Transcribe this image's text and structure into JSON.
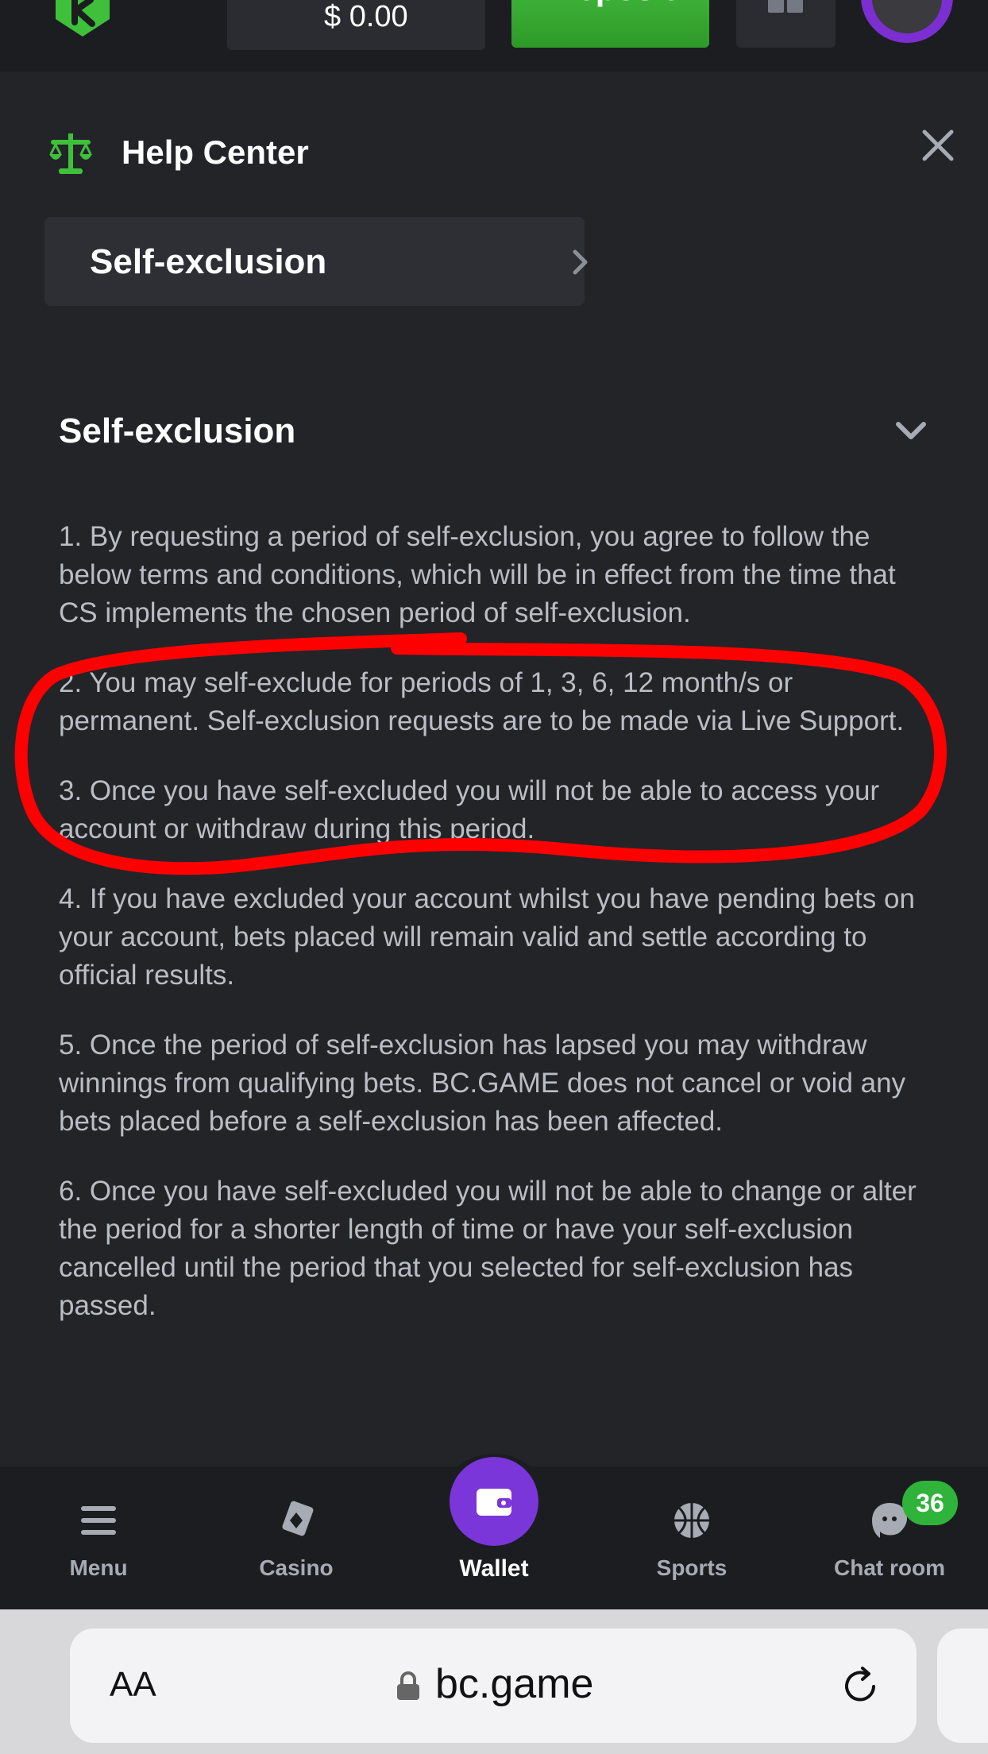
{
  "header": {
    "balance": "$ 0.00",
    "deposit_label": "Deposit"
  },
  "help_center": {
    "title": "Help Center",
    "selector_label": "Self-exclusion",
    "section_title": "Self-exclusion",
    "paragraphs": [
      "1. By requesting a period of self-exclusion, you agree to follow the below terms and conditions, which will be in effect from the time that CS implements the chosen period of self-exclusion.",
      "2. You may self-exclude for periods of 1, 3, 6, 12 month/s or permanent. Self-exclusion requests are to be made via Live Support.",
      "3. Once you have self-excluded you will not be able to access your account or withdraw during this period.",
      "4. If you have excluded your account whilst you have pending bets on your account, bets placed will remain valid and settle according to official results.",
      "5. Once the period of self-exclusion has lapsed you may withdraw winnings from qualifying bets. BC.GAME does not cancel or void any bets placed before a self-exclusion has been affected.",
      "6. Once you have self-excluded you will not be able to change or alter the period for a shorter length of time or have your self-exclusion cancelled until the period that you selected for self-exclusion has passed."
    ]
  },
  "bottom_nav": {
    "items": [
      {
        "label": "Menu",
        "icon": "menu-icon"
      },
      {
        "label": "Casino",
        "icon": "casino-icon"
      },
      {
        "label": "Wallet",
        "icon": "wallet-icon"
      },
      {
        "label": "Sports",
        "icon": "sports-icon"
      },
      {
        "label": "Chat room",
        "icon": "chat-icon"
      }
    ],
    "chat_badge": "36"
  },
  "browser": {
    "aa_label": "AA",
    "url": "bc.game"
  },
  "colors": {
    "background": "#232428",
    "accent_green": "#2fb33a",
    "wallet_purple": "#7a36d8",
    "annotation_red": "#ff0000"
  }
}
